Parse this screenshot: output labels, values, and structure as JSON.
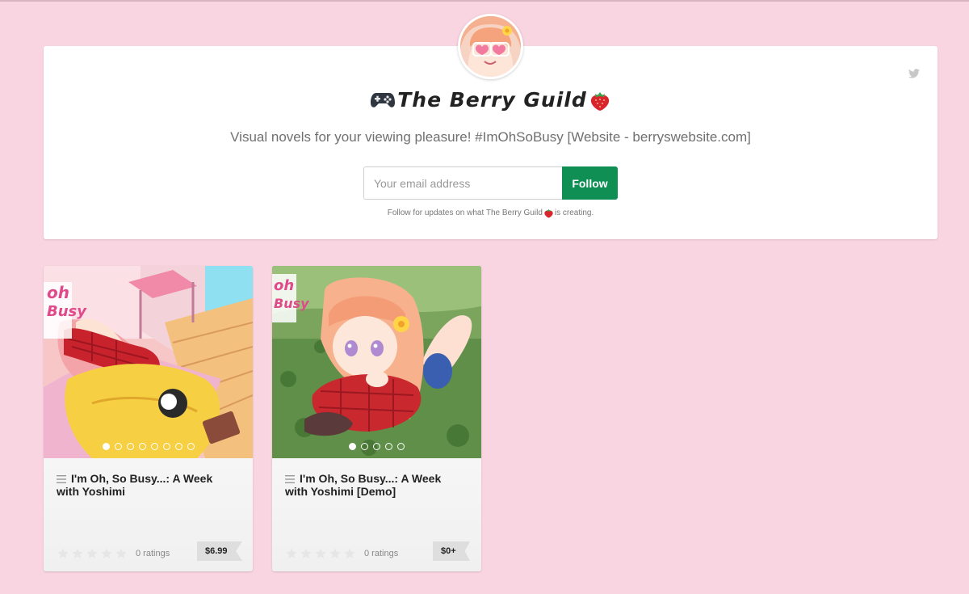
{
  "profile": {
    "title": "The Berry Guild",
    "title_left_icon": "game-controller-icon",
    "title_right_icon": "strawberry-icon",
    "tagline": "Visual novels for your viewing pleasure! #ImOhSoBusy [Website - berryswebsite.com]",
    "email_placeholder": "Your email address",
    "email_value": "",
    "follow_label": "Follow",
    "follow_note_prefix": "Follow for updates on what The Berry Guild",
    "follow_note_suffix": " is creating.",
    "social_icon": "twitter-icon",
    "accent_color": "#108f55",
    "background_color": "#f9d5e1"
  },
  "games": [
    {
      "title": "I'm Oh, So Busy...: A Week with Yoshimi",
      "ratings": "0 ratings",
      "rating_stars": 0,
      "price": "$6.99",
      "carousel_dots": 8,
      "active_dot": 1
    },
    {
      "title": "I'm Oh, So Busy...: A Week with Yoshimi [Demo]",
      "ratings": "0 ratings",
      "rating_stars": 0,
      "price": "$0+",
      "carousel_dots": 5,
      "active_dot": 1
    }
  ]
}
